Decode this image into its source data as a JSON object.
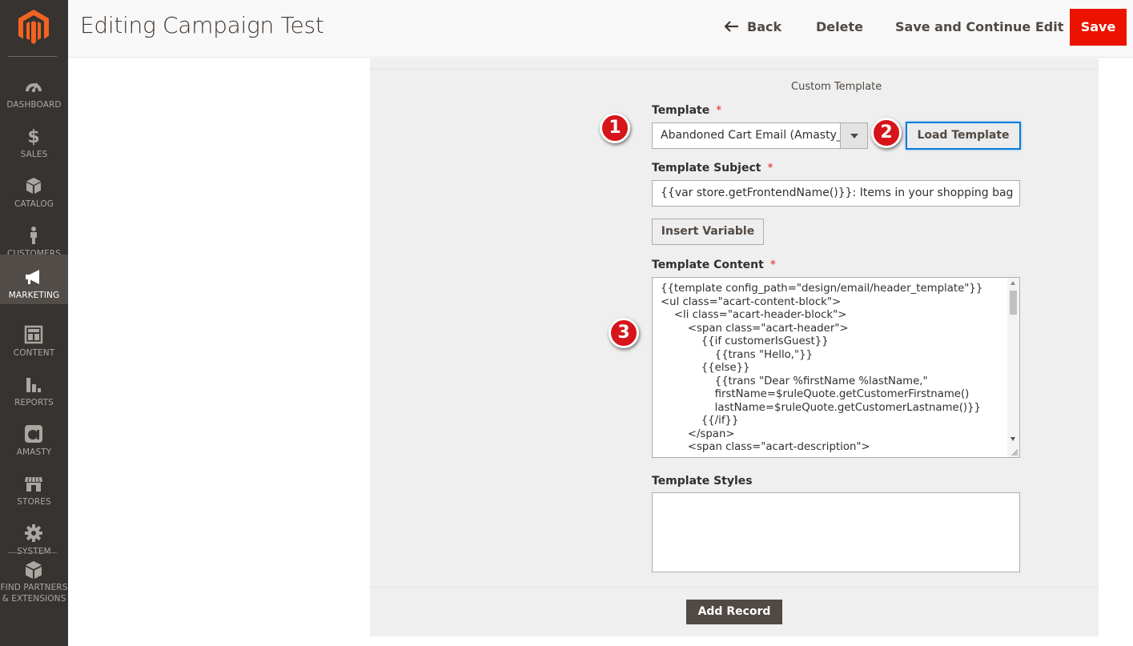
{
  "sidebar": {
    "logo_icon": "magento-logo-icon",
    "items": [
      {
        "label": "DASHBOARD",
        "icon": "dashboard-icon"
      },
      {
        "label": "SALES",
        "icon": "dollar-icon"
      },
      {
        "label": "CATALOG",
        "icon": "cube-icon"
      },
      {
        "label": "CUSTOMERS",
        "icon": "person-icon"
      },
      {
        "label": "MARKETING",
        "icon": "megaphone-icon"
      },
      {
        "label": "CONTENT",
        "icon": "layout-icon"
      },
      {
        "label": "REPORTS",
        "icon": "bar-chart-icon"
      },
      {
        "label": "AMASTY",
        "icon": "amasty-icon"
      },
      {
        "label": "STORES",
        "icon": "store-icon"
      },
      {
        "label": "SYSTEM",
        "icon": "gear-icon"
      },
      {
        "label": "FIND PARTNERS\n& EXTENSIONS",
        "icon": "box-stack-icon"
      }
    ],
    "active_item": "MARKETING",
    "bg_color": "#373330"
  },
  "header": {
    "title": "Editing Campaign Test",
    "back_label": "Back",
    "delete_label": "Delete",
    "save_continue_label": "Save and Continue Edit",
    "save_label": "Save",
    "save_color": "#eb1300"
  },
  "form": {
    "section_title": "Custom Template",
    "template_label": "Template",
    "template_value": "Abandoned Cart Email (Amasty_Acart)",
    "load_template_label": "Load Template",
    "subject_label": "Template Subject",
    "subject_value": "{{var store.getFrontendName()}}: Items in your shopping bag",
    "insert_variable_label": "Insert Variable",
    "content_label": "Template Content",
    "content_value": "{{template config_path=\"design/email/header_template\"}}\n<ul class=\"acart-content-block\">\n    <li class=\"acart-header-block\">\n        <span class=\"acart-header\">\n            {{if customerIsGuest}}\n                {{trans \"Hello,\"}}\n            {{else}}\n                {{trans \"Dear %firstName %lastName,\"\n                firstName=$ruleQuote.getCustomerFirstname()\n                lastName=$ruleQuote.getCustomerLastname()}}\n            {{/if}}\n        </span>\n        <span class=\"acart-description\">\n            ",
    "styles_label": "Template Styles",
    "styles_value": "",
    "required_mark": "*",
    "add_record_label": "Add Record"
  },
  "callouts": [
    "1",
    "2",
    "3"
  ]
}
